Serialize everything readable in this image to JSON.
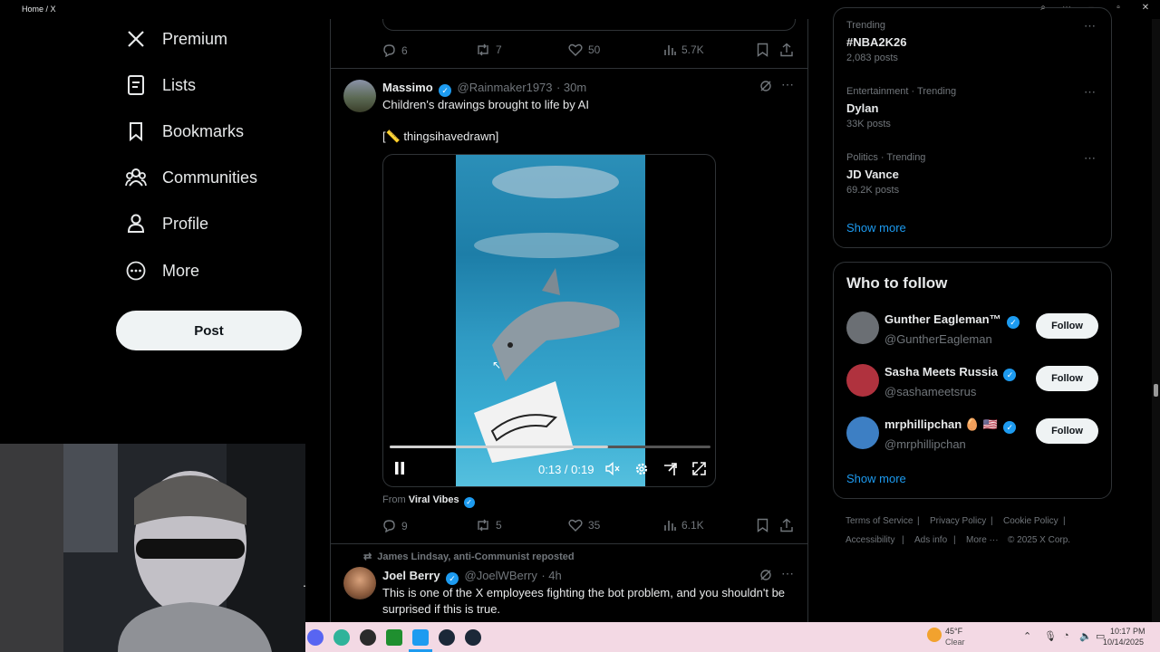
{
  "window": {
    "title": "Home / X"
  },
  "nav": {
    "items": [
      {
        "label": "Premium"
      },
      {
        "label": "Lists"
      },
      {
        "label": "Bookmarks"
      },
      {
        "label": "Communities"
      },
      {
        "label": "Profile"
      },
      {
        "label": "More"
      }
    ],
    "post_label": "Post"
  },
  "prev_tweet": {
    "replies": "6",
    "reposts": "7",
    "likes": "50",
    "views": "5.7K"
  },
  "tweet1": {
    "name": "Massimo",
    "handle": "@Rainmaker1973",
    "time": "· 30m",
    "text": "Children's drawings brought to life by AI",
    "text2": "[📏 thingsihavedrawn]",
    "video_time": "0:13 / 0:19",
    "video_progress": 0.68,
    "from_prefix": "From",
    "from_source": "Viral Vibes",
    "replies": "9",
    "reposts": "5",
    "likes": "35",
    "views": "6.1K"
  },
  "tweet2": {
    "repost_note": "James Lindsay, anti-Communist reposted",
    "name": "Joel Berry",
    "handle": "@JoelWBerry",
    "time": "· 4h",
    "text": "This is one of the X employees fighting the bot problem, and you shouldn't be surprised if this is true."
  },
  "trends": [
    {
      "context": "Trending",
      "topic": "#NBA2K26",
      "posts": "2,083 posts"
    },
    {
      "context": "Entertainment · Trending",
      "topic": "Dylan",
      "posts": "33K posts"
    },
    {
      "context": "Politics · Trending",
      "topic": "JD Vance",
      "posts": "69.2K posts"
    }
  ],
  "trends_show_more": "Show more",
  "who_to_follow": {
    "title": "Who to follow",
    "users": [
      {
        "name": "Gunther Eagleman™",
        "handle": "@GuntherEagleman",
        "button": "Follow",
        "color": "#6b6f74"
      },
      {
        "name": "Sasha Meets Russia",
        "handle": "@sashameetsrus",
        "button": "Follow",
        "color": "#b0323e"
      },
      {
        "name": "mrphillipchan 🥚 🇺🇸",
        "handle": "@mrphillipchan",
        "button": "Follow",
        "color": "#3d7fc4"
      }
    ],
    "show_more": "Show more"
  },
  "footer": {
    "links": [
      "Terms of Service",
      "Privacy Policy",
      "Cookie Policy",
      "Accessibility",
      "Ads info",
      "More ···"
    ],
    "copyright": "© 2025 X Corp."
  },
  "taskbar": {
    "weather_temp": "45°F",
    "weather_desc": "Clear",
    "time": "10:17 PM",
    "date": "10/14/2025"
  },
  "colors": {
    "accent": "#1d9bf0",
    "background": "#000000",
    "border": "#2f3336",
    "muted": "#71767b"
  }
}
